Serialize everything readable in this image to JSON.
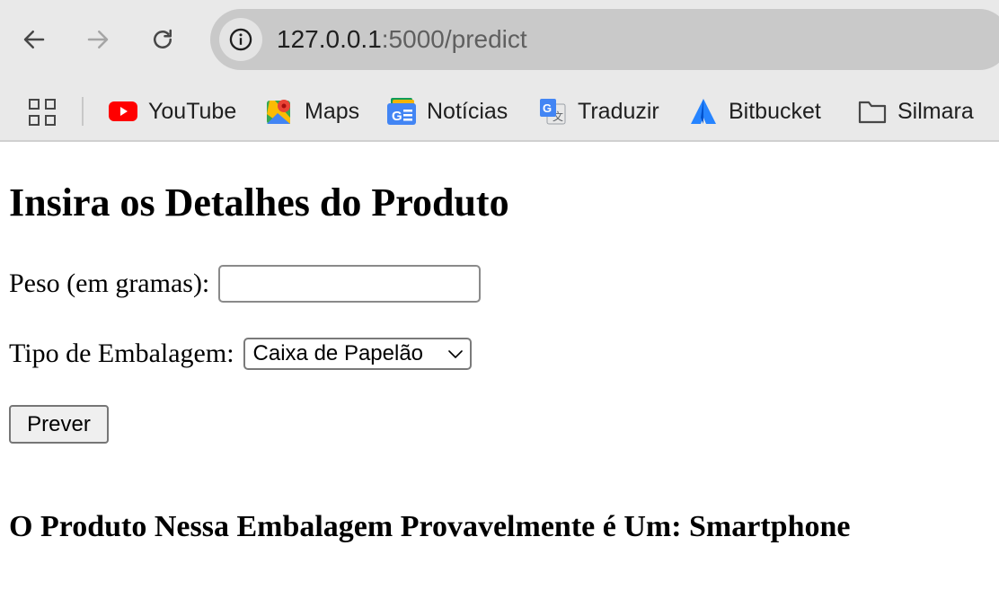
{
  "browser": {
    "url_host": "127.0.0.1",
    "url_path": ":5000/predict",
    "bookmarks": [
      {
        "label": "YouTube",
        "icon": "youtube-icon"
      },
      {
        "label": "Maps",
        "icon": "maps-icon"
      },
      {
        "label": "Notícias",
        "icon": "news-icon"
      },
      {
        "label": "Traduzir",
        "icon": "translate-icon"
      },
      {
        "label": "Bitbucket",
        "icon": "bitbucket-icon"
      },
      {
        "label": "Silmara",
        "icon": "folder-icon"
      }
    ],
    "colors": {
      "toolbar_bg": "#e9e9e9",
      "omnibox_bg": "#c9c9c9"
    }
  },
  "page": {
    "title": "Insira os Detalhes do Produto",
    "weight_label": "Peso (em gramas):",
    "weight_value": "",
    "packaging_label": "Tipo de Embalagem:",
    "packaging_selected": "Caixa de Papelão",
    "submit_label": "Prever",
    "result_text": "O Produto Nessa Embalagem Provavelmente é Um: Smartphone"
  }
}
